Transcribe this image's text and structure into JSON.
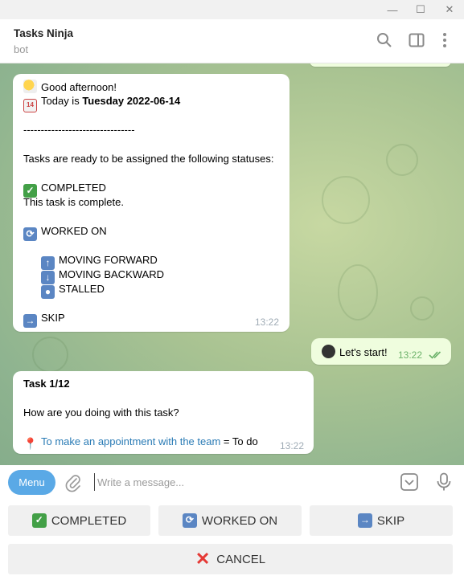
{
  "window": {
    "minimize": "—",
    "maximize": "☐",
    "close": "✕"
  },
  "header": {
    "title": "Tasks Ninja",
    "subtitle": "bot"
  },
  "messages": {
    "welcome": {
      "greeting": "Good afternoon!",
      "today_prefix": "Today is ",
      "today_date": "Tuesday 2022-06-14",
      "separator": "--------------------------------",
      "intro": "Tasks are ready to be assigned the following statuses:",
      "completed_label": "COMPLETED",
      "completed_desc": "This task is complete.",
      "worked_on_label": "WORKED ON",
      "moving_forward": "MOVING FORWARD",
      "moving_backward": "MOVING BACKWARD",
      "stalled": "STALLED",
      "skip_label": "SKIP",
      "time": "13:22"
    },
    "user": {
      "text": "Let's start!",
      "time": "13:22"
    },
    "task": {
      "title": "Task 1/12",
      "question": "How are you doing with this task?",
      "task_link": "To make an appointment with the team",
      "task_suffix": " = To do",
      "time": "13:22"
    }
  },
  "composer": {
    "menu_label": "Menu",
    "placeholder": "Write a message..."
  },
  "keyboard": {
    "completed": "COMPLETED",
    "worked_on": "WORKED ON",
    "skip": "SKIP",
    "cancel": "CANCEL"
  },
  "colors": {
    "menu_button": "#5aa9e6",
    "outgoing_bubble": "#effdde",
    "link": "#2a7bb5",
    "cancel_mark": "#e53935",
    "chat_background": "#a9c392"
  }
}
